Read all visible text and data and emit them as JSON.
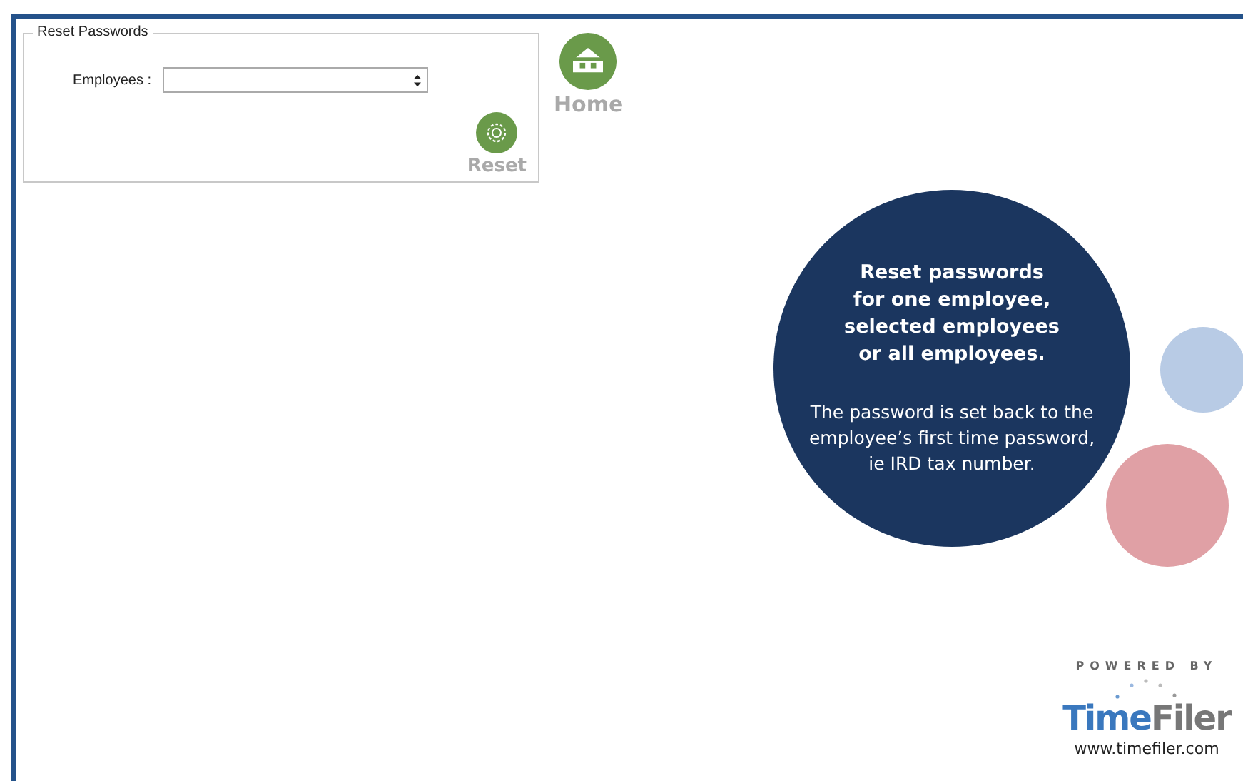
{
  "group": {
    "title": "Reset Passwords",
    "field_label": "Employees :",
    "reset_label": "Reset"
  },
  "home": {
    "label": "Home"
  },
  "info": {
    "heading": "Reset passwords\nfor one employee,\nselected employees\nor all employees.",
    "body": "The password is set back to the\nemployee’s first time password,\nie IRD tax number."
  },
  "logo": {
    "powered_by": "POWERED BY",
    "brand_first": "Time",
    "brand_second": "Filer",
    "url": "www.timefiler.com"
  }
}
